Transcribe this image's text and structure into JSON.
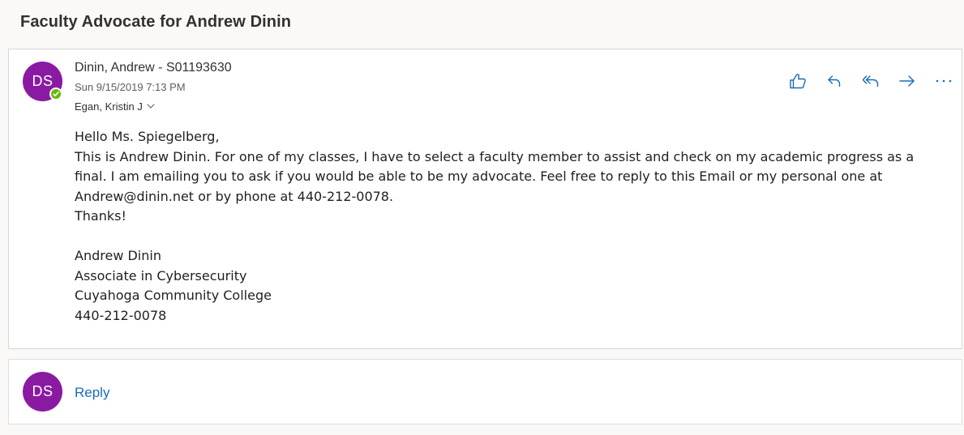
{
  "conversation": {
    "subject": "Faculty Advocate for Andrew Dinin"
  },
  "message": {
    "avatar_initials": "DS",
    "sender": "Dinin, Andrew - S01193630",
    "date": "Sun 9/15/2019 7:13 PM",
    "recipient": "Egan, Kristin J",
    "presence_status": "available",
    "presence_color": "#6bb700",
    "avatar_color": "#8b1aa3",
    "actions": [
      {
        "name": "like",
        "icon": "thumbs-up-icon"
      },
      {
        "name": "reply",
        "icon": "reply-icon"
      },
      {
        "name": "reply-all",
        "icon": "reply-all-icon"
      },
      {
        "name": "forward",
        "icon": "forward-icon"
      },
      {
        "name": "more",
        "icon": "more-icon"
      }
    ],
    "body": {
      "greeting": "Hello Ms. Spiegelberg,",
      "paragraph_lines": [
        "This is Andrew Dinin. For one of my classes, I have to select a faculty member to assist and check on my academic progress as a",
        "final. I am emailing you to ask if you would be able to be my advocate. Feel free to reply to this Email or my personal one at",
        "Andrew@dinin.net or by phone at 440-212-0078."
      ],
      "closing": "Thanks!",
      "signature": [
        "Andrew Dinin",
        "Associate in Cybersecurity",
        "Cuyahoga Community College",
        "440-212-0078"
      ]
    }
  },
  "reply_bar": {
    "avatar_initials": "DS",
    "label": "Reply",
    "link_color": "#1a6bb8"
  }
}
